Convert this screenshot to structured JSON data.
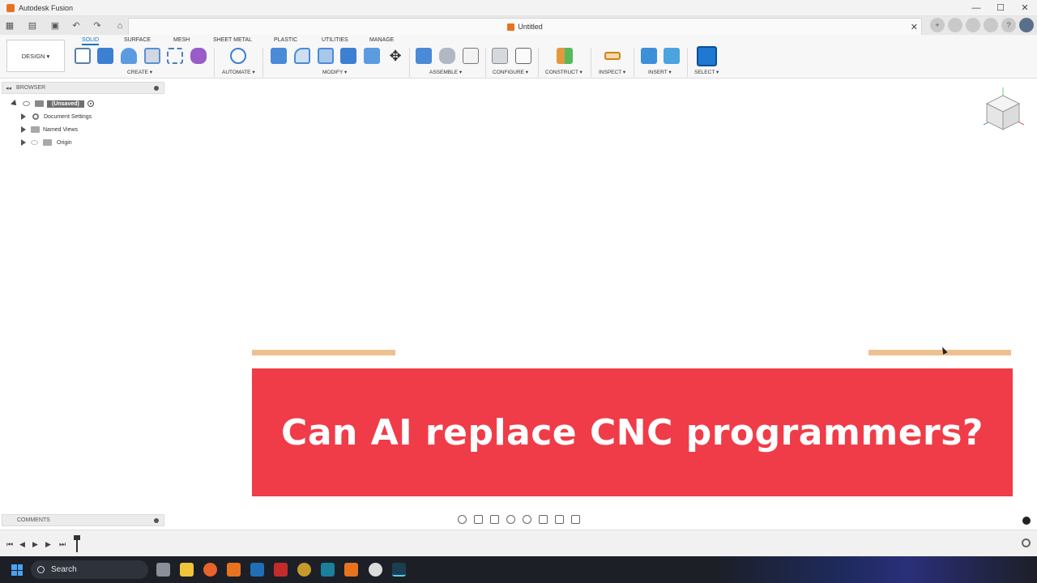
{
  "window": {
    "app_title": "Autodesk Fusion",
    "minimize": "—",
    "maximize": "☐",
    "close": "✕"
  },
  "tab": {
    "title": "Untitled",
    "close": "✕"
  },
  "ribbon": {
    "workspace": "DESIGN",
    "workspace_caret": "▾",
    "tabs": [
      "SOLID",
      "SURFACE",
      "MESH",
      "SHEET METAL",
      "PLASTIC",
      "UTILITIES",
      "MANAGE"
    ],
    "groups": [
      "CREATE",
      "AUTOMATE",
      "MODIFY",
      "ASSEMBLE",
      "CONFIGURE",
      "CONSTRUCT",
      "INSPECT",
      "INSERT",
      "SELECT"
    ]
  },
  "browser": {
    "header": "BROWSER",
    "root_label": "(Unsaved)",
    "items": [
      "Document Settings",
      "Named Views",
      "Origin"
    ]
  },
  "comments": {
    "label": "COMMENTS"
  },
  "thumbnail": {
    "headline": "Can AI replace CNC programmers?"
  },
  "taskbar": {
    "search_label": "Search"
  },
  "colors": {
    "banner": "#f03c48",
    "stripe": "#efc08f",
    "accent": "#1a73c7"
  }
}
